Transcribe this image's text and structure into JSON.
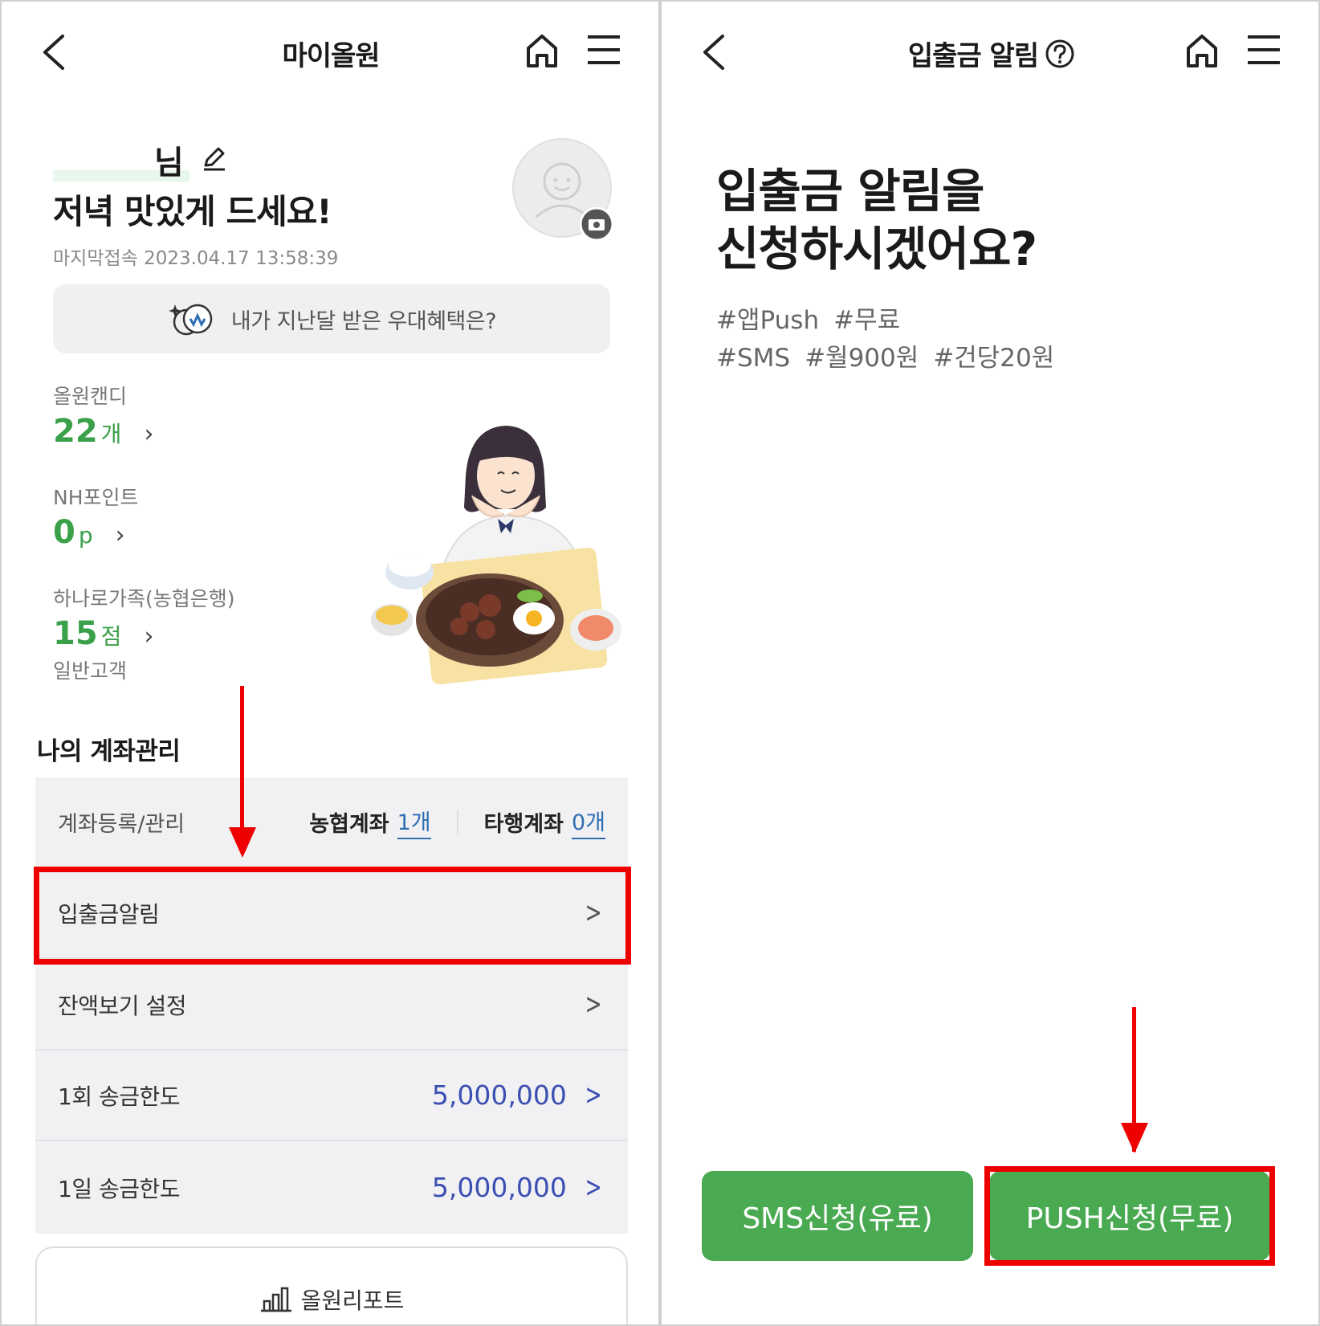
{
  "left": {
    "header": {
      "title": "마이올원"
    },
    "greeting": {
      "name_suffix": "님",
      "message": "저녁 맛있게 드세요!",
      "last_login": "마지막접속 2023.04.17 13:58:39"
    },
    "benefit": {
      "label": "내가 지난달 받은 우대혜택은?"
    },
    "stats": [
      {
        "label": "올원캔디",
        "value": "22",
        "unit": "개"
      },
      {
        "label": "NH포인트",
        "value": "0",
        "unit": "p"
      },
      {
        "label": "하나로가족(농협은행)",
        "value": "15",
        "unit": "점",
        "sub": "일반고객"
      }
    ],
    "account_section": {
      "title": "나의 계좌관리",
      "register_label": "계좌등록/관리",
      "nh_label": "농협계좌",
      "nh_count": "1개",
      "other_label": "타행계좌",
      "other_count": "0개",
      "rows": [
        {
          "label": "입출금알림"
        },
        {
          "label": "잔액보기 설정"
        },
        {
          "label": "1회 송금한도",
          "amount": "5,000,000"
        },
        {
          "label": "1일 송금한도",
          "amount": "5,000,000"
        }
      ],
      "report_label": "올원리포트"
    },
    "colors": {
      "accent_green": "#3aa04a",
      "amount_blue": "#3b4fb2",
      "highlight_red": "#e00000"
    }
  },
  "right": {
    "header": {
      "title": "입출금 알림"
    },
    "heading_line1": "입출금 알림을",
    "heading_line2": "신청하시겠어요?",
    "tags_line1": [
      "#앱Push",
      "#무료"
    ],
    "tags_line2": [
      "#SMS",
      "#월900원",
      "#건당20원"
    ],
    "buttons": {
      "sms": "SMS신청(유료)",
      "push": "PUSH신청(무료)"
    },
    "colors": {
      "button_green": "#4aaa52"
    }
  },
  "icons": [
    "back-chevron-icon",
    "home-icon",
    "hamburger-menu-icon",
    "edit-pencil-icon",
    "camera-icon",
    "help-circle-icon",
    "bar-chart-icon"
  ]
}
